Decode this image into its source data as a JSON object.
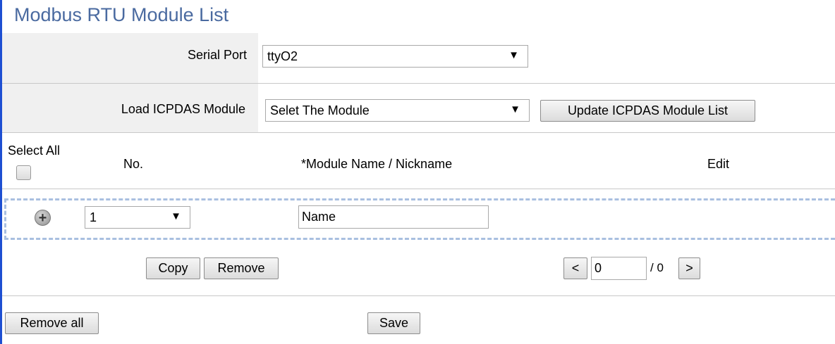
{
  "title": "Modbus RTU Module List",
  "serial_port": {
    "label": "Serial Port",
    "value": "ttyO2"
  },
  "load_module": {
    "label": "Load ICPDAS Module",
    "value": "Selet The Module",
    "update_button": "Update ICPDAS Module List"
  },
  "table": {
    "select_all": "Select All",
    "columns": {
      "no": "No.",
      "name": "*Module Name / Nickname",
      "edit": "Edit"
    },
    "rows": [
      {
        "no": "1",
        "name": "Name"
      }
    ]
  },
  "actions": {
    "copy": "Copy",
    "remove": "Remove"
  },
  "pager": {
    "prev": "<",
    "current": "0",
    "total": "/ 0",
    "next": ">"
  },
  "footer": {
    "remove_all": "Remove all",
    "save": "Save"
  },
  "icons": {
    "dropdown": "▼",
    "add_row": "+"
  }
}
